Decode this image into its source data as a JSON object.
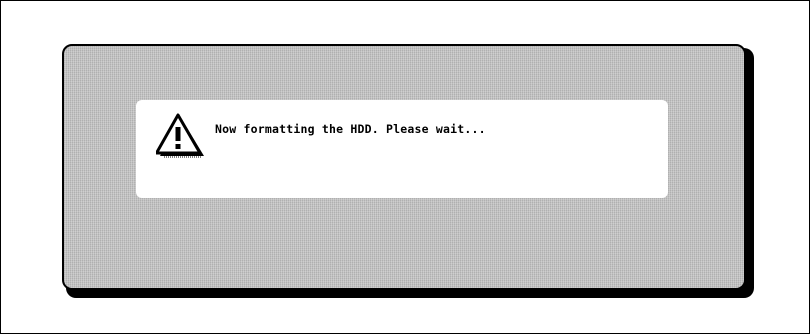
{
  "dialog": {
    "message": "Now formatting the HDD. Please wait...",
    "icon": "warning-triangle-icon"
  },
  "colors": {
    "panel": "#c4c4c4",
    "message_background": "#ffffff",
    "outline": "#000000"
  }
}
